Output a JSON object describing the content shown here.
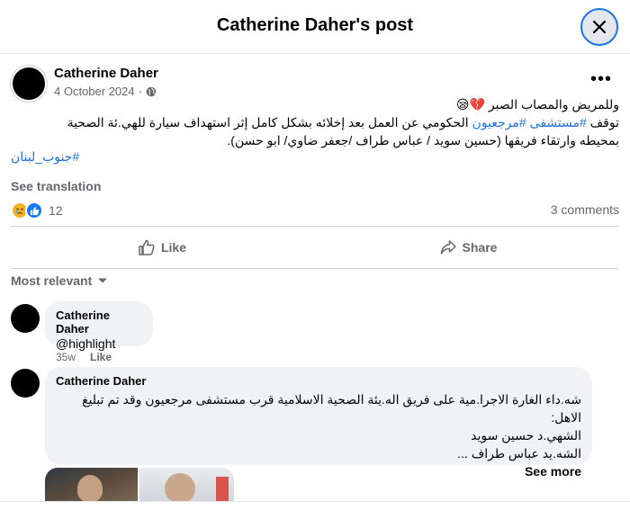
{
  "dialog": {
    "title": "Catherine Daher's post"
  },
  "post": {
    "author": "Catherine Daher",
    "date": "4 October 2024",
    "date_separator": "·",
    "more_label": "•••",
    "text_line1": "وللمريض والمصاب الصبر 💔😪",
    "text_line2_pre": "توقف ",
    "text_line2_tag1": "#مستشفى",
    "text_line2_space": " ",
    "text_line2_tag2": "#مرجعيون",
    "text_line2_post": " الحكومي عن العمل بعد إخلائه بشكل كامل إثر استهداف سيارة للهي.ئة الصحية",
    "text_line3": "بمحيطه وارتقاء فريقها (حسين سويد  / عباس طراف /جعفر ضاوي/ ابو حسن).",
    "tag_line": "#جنوب_لبنان",
    "see_translation": "See translation",
    "reaction_count": "12",
    "comments_count": "3 comments",
    "like_label": "Like",
    "share_label": "Share"
  },
  "comments_section": {
    "sort_label": "Most relevant",
    "comments": [
      {
        "author": "Catherine Daher",
        "text": "@highlight",
        "time": "35w",
        "like": "Like"
      },
      {
        "author": "Catherine Daher",
        "line1": "شه.داء الغارة الاجرا.مية على فريق اله.يئة الصحية الاسلامية قرب مستشفى مرجعيون وقد تم تبليغ",
        "line2": "الاهل:",
        "line3": "الشهي.د حسين سويد",
        "line4": "الشه.يد عباس طراف ...",
        "see_more": "See more"
      }
    ]
  },
  "colors": {
    "link": "#216fdb",
    "secondary_text": "#65676b",
    "bubble_bg": "#f0f2f5",
    "focus_ring": "#1b74e4"
  },
  "icons": {
    "close": "close-icon",
    "globe": "globe-icon",
    "like": "thumbs-up-icon",
    "share": "share-icon",
    "sort": "chevron-down-icon"
  }
}
